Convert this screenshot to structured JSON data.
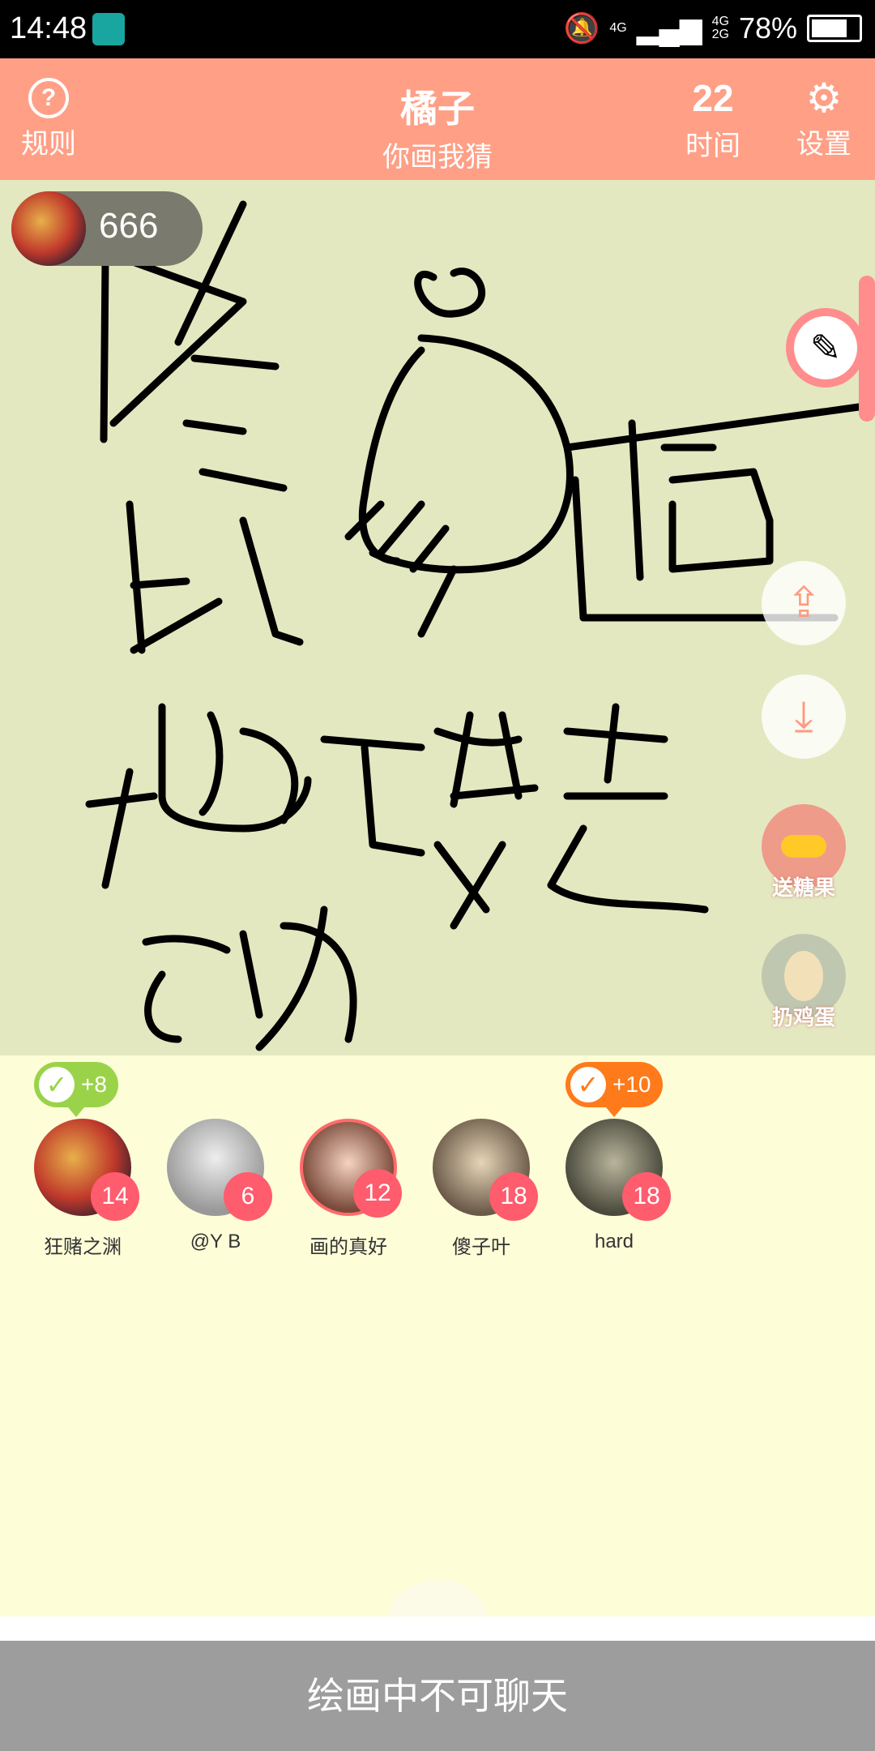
{
  "status_bar": {
    "time": "14:48",
    "net1": "4G",
    "net2": "4G",
    "net3": "2G",
    "battery": "78%",
    "battery_level": 0.78
  },
  "header": {
    "rules_label": "规则",
    "rules_icon": "question-icon",
    "title": "橘子",
    "subtitle": "你画我猜",
    "timer_value": "22",
    "timer_label": "时间",
    "settings_label": "设置",
    "settings_icon": "gear-icon"
  },
  "drawer": {
    "score": "666"
  },
  "side_buttons": {
    "candy_label": "送糖果",
    "egg_label": "扔鸡蛋"
  },
  "guesses": [
    {
      "text": "+8"
    },
    {
      "text": "+10"
    }
  ],
  "players": [
    {
      "name": "狂赌之渊",
      "score": "14"
    },
    {
      "name": "@Y B",
      "score": "6"
    },
    {
      "name": "画的真好",
      "score": "12"
    },
    {
      "name": "傻子叶",
      "score": "18"
    },
    {
      "name": "hard",
      "score": "18"
    }
  ],
  "chat": {
    "disabled_text": "绘画中不可聊天"
  }
}
